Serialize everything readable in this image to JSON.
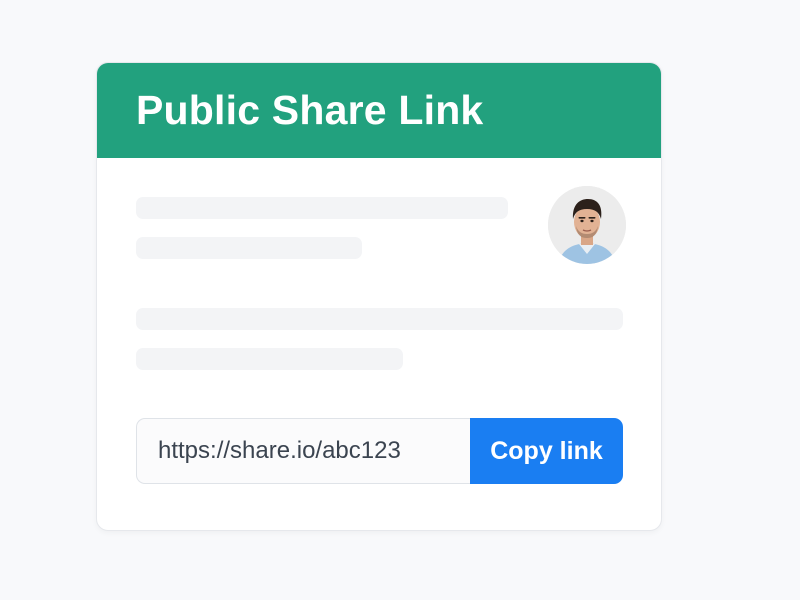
{
  "card": {
    "title": "Public Share Link"
  },
  "share": {
    "url": "https://share.io/abc123",
    "copy_label": "Copy link"
  },
  "icons": {
    "avatar": "user-avatar-photo"
  },
  "colors": {
    "header": "#22a17e",
    "button": "#1a7ef2",
    "page_background": "#f8f9fb"
  }
}
